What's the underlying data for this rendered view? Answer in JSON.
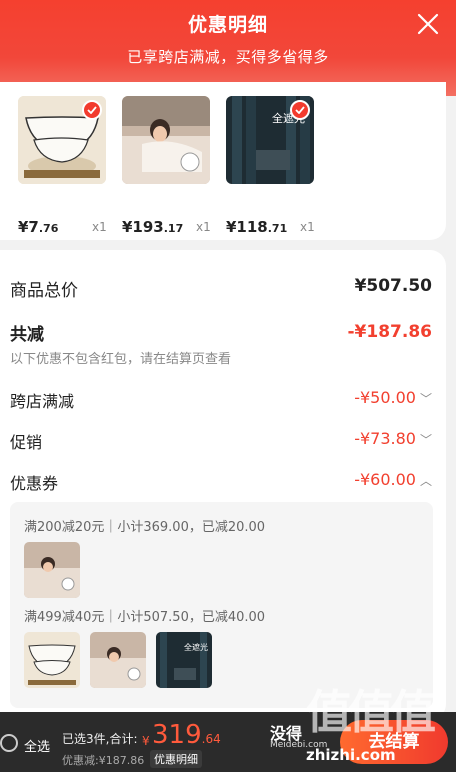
{
  "header": {
    "title": "优惠明细",
    "subtitle": "已享跨店满减，买得多省得多"
  },
  "products": [
    {
      "price_main": "¥7",
      "price_cents": ".76",
      "qty": "x1",
      "image": "ceramic-bowls"
    },
    {
      "price_main": "¥193",
      "price_cents": ".17",
      "qty": "x1",
      "image": "woman-on-sofa"
    },
    {
      "price_main": "¥118",
      "price_cents": ".71",
      "qty": "x1",
      "image": "blackout-curtain",
      "image_text": "全遮光"
    }
  ],
  "summary": {
    "goods_total_label": "商品总价",
    "goods_total_value": "¥507.50",
    "total_reduction_label": "共减",
    "total_reduction_value": "-¥187.86",
    "note": "以下优惠不包含红包，请在结算页查看",
    "items": [
      {
        "label": "跨店满减",
        "value": "-¥50.00",
        "chevron": "﹀"
      },
      {
        "label": "促销",
        "value": "-¥73.80",
        "chevron": "﹀"
      },
      {
        "label": "优惠券",
        "value": "-¥60.00",
        "chevron": "︿"
      }
    ]
  },
  "coupons": [
    {
      "text": "满200减20元｜小计369.00，已减20.00"
    },
    {
      "text": "满499减40元｜小计507.50，已减40.00"
    }
  ],
  "bottom_bar": {
    "select_all": "全选",
    "selected": "已选3件,合计:",
    "currency": "¥",
    "total_main": "319",
    "total_cents": ".64",
    "discount": "优惠减:¥187.86",
    "detail_button": "优惠明细",
    "checkout": "去结算"
  },
  "watermark": {
    "logo": "值值值",
    "text": "没得",
    "site": "Meidebi.com",
    "domain": "zhizhi.com"
  },
  "colors": {
    "accent": "#f2402f",
    "header_bg": "#f5402f",
    "bottom_bar_bg": "#2b2b2b"
  }
}
